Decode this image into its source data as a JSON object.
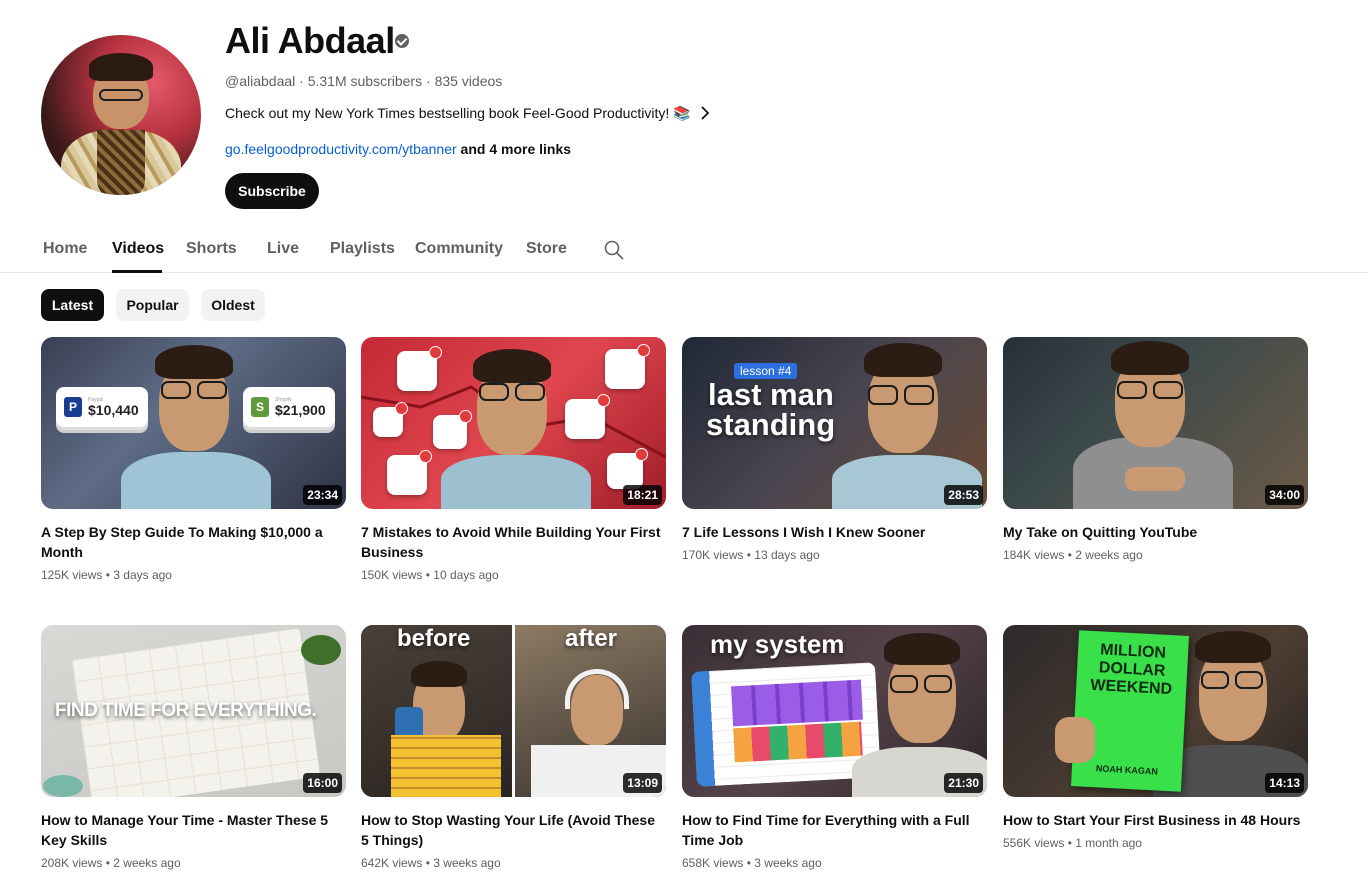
{
  "channel": {
    "name": "Ali Abdaal",
    "handle": "@aliabdaal",
    "subscribers": "5.31M subscribers",
    "videos_count": "835 videos",
    "separator": "·",
    "description": "Check out my New York Times bestselling book Feel-Good Productivity! 📚",
    "link": "go.feelgoodproductivity.com/ytbanner",
    "more_links": "and 4 more links",
    "subscribe_label": "Subscribe"
  },
  "tabs": [
    {
      "label": "Home"
    },
    {
      "label": "Videos",
      "active": true
    },
    {
      "label": "Shorts"
    },
    {
      "label": "Live"
    },
    {
      "label": "Playlists"
    },
    {
      "label": "Community"
    },
    {
      "label": "Store"
    }
  ],
  "chips": [
    {
      "label": "Latest",
      "active": true
    },
    {
      "label": "Popular"
    },
    {
      "label": "Oldest"
    }
  ],
  "videos": [
    {
      "title": "A Step By Step Guide To Making $10,000 a Month",
      "views": "125K views",
      "age": "3 days ago",
      "duration": "23:34",
      "thumb": {
        "paypal_label": "Paypal",
        "paypal_amount": "$10,440",
        "shopify_label": "Shopify",
        "shopify_amount": "$21,900",
        "pp_logo": "P",
        "sh_logo": "S"
      }
    },
    {
      "title": "7 Mistakes to Avoid While Building Your First Business",
      "views": "150K views",
      "age": "10 days ago",
      "duration": "18:21"
    },
    {
      "title": "7 Life Lessons I Wish I Knew Sooner",
      "views": "170K views",
      "age": "13 days ago",
      "duration": "28:53",
      "thumb": {
        "tag": "lesson #4",
        "line1": "last man",
        "line2": "standing"
      }
    },
    {
      "title": "My Take on Quitting YouTube",
      "views": "184K views",
      "age": "2 weeks ago",
      "duration": "34:00"
    },
    {
      "title": "How to Manage Your Time - Master These 5 Key Skills",
      "views": "208K views",
      "age": "2 weeks ago",
      "duration": "16:00",
      "thumb": {
        "text": "FIND TIME FOR EVERYTHING."
      }
    },
    {
      "title": "How to Stop Wasting Your Life (Avoid These 5 Things)",
      "views": "642K views",
      "age": "3 weeks ago",
      "duration": "13:09",
      "thumb": {
        "left": "before",
        "right": "after"
      }
    },
    {
      "title": "How to Find Time for Everything with a Full Time Job",
      "views": "658K views",
      "age": "3 weeks ago",
      "duration": "21:30",
      "thumb": {
        "text": "my system"
      }
    },
    {
      "title": "How to Start Your First Business in 48 Hours",
      "views": "556K views",
      "age": "1 month ago",
      "duration": "14:13",
      "thumb": {
        "book_title": "MILLION DOLLAR WEEKEND",
        "author": "NOAH KAGAN"
      }
    }
  ],
  "icons": {
    "verified": "verified-check-icon",
    "chevron": "chevron-right-icon",
    "search": "search-icon"
  },
  "colors": {
    "link": "#065fd4",
    "text": "#0f0f0f",
    "muted": "#606060",
    "chip_bg": "#f2f2f2"
  }
}
